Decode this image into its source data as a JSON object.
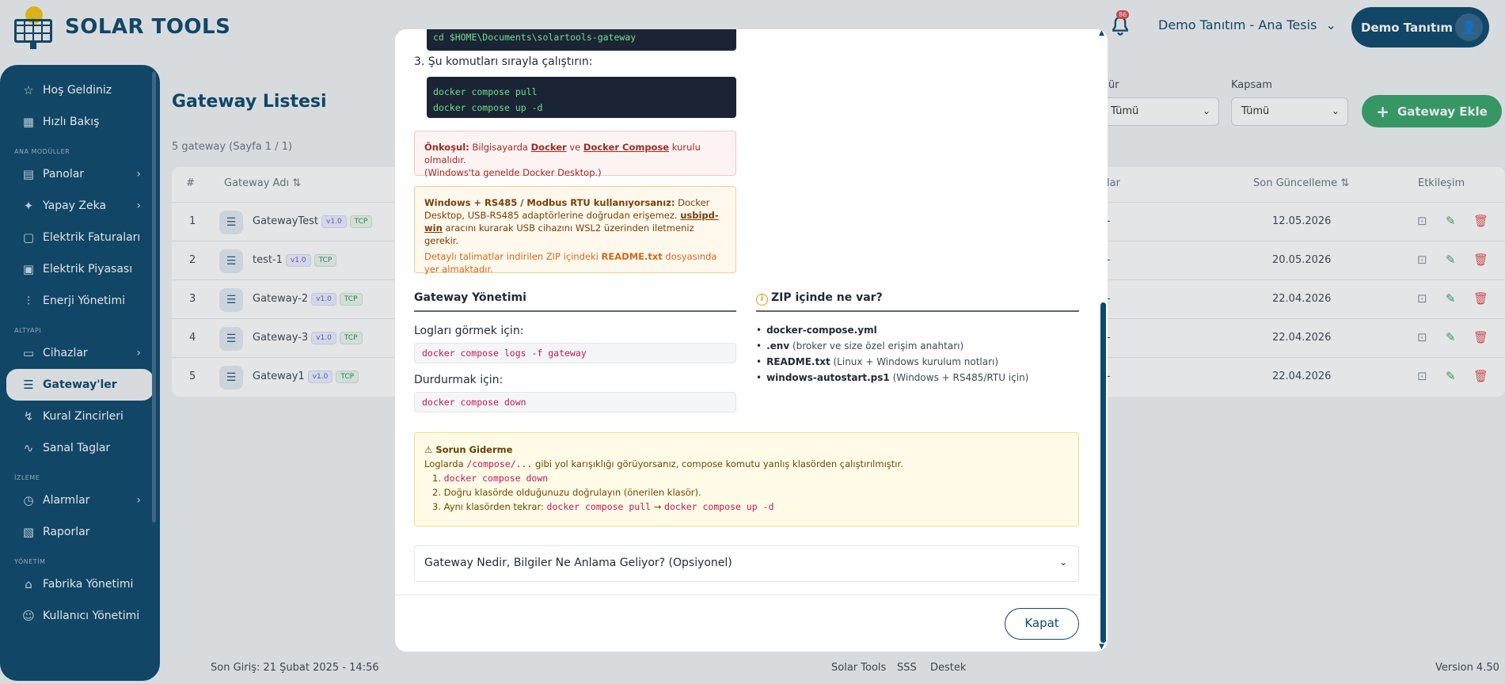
{
  "app": {
    "name": "SOLAR TOOLS"
  },
  "header": {
    "notification_count": "86",
    "tenant": "Demo Tanıtım - Ana Tesis",
    "user": "Demo Tanıtım"
  },
  "sidebar": {
    "items_top": [
      {
        "label": "Hoş Geldiniz",
        "icon": "star-icon"
      },
      {
        "label": "Hızlı Bakış",
        "icon": "grid-icon"
      }
    ],
    "section_modules": "ANA MODÜLLER",
    "items_modules": [
      {
        "label": "Panolar",
        "icon": "dashboard-icon"
      },
      {
        "label": "Yapay Zeka",
        "icon": "ai-icon"
      },
      {
        "label": "Elektrik Faturaları",
        "icon": "invoice-icon"
      },
      {
        "label": "Elektrik Piyasası",
        "icon": "market-icon"
      },
      {
        "label": "Enerji Yönetimi",
        "icon": "sliders-icon"
      }
    ],
    "section_infra": "ALTYAPI",
    "items_infra": [
      {
        "label": "Cihazlar",
        "icon": "monitor-icon"
      },
      {
        "label": "Gateway'ler",
        "icon": "server-icon"
      },
      {
        "label": "Kural Zincirleri",
        "icon": "chain-icon"
      },
      {
        "label": "Sanal Taglar",
        "icon": "pulse-icon"
      }
    ],
    "section_monitor": "İZLEME",
    "items_monitor": [
      {
        "label": "Alarmlar",
        "icon": "alarm-icon"
      },
      {
        "label": "Raporlar",
        "icon": "report-icon"
      }
    ],
    "section_admin": "YÖNETİM",
    "items_admin": [
      {
        "label": "Fabrika Yönetimi",
        "icon": "factory-icon"
      },
      {
        "label": "Kullanıcı Yönetimi",
        "icon": "users-icon"
      }
    ]
  },
  "page": {
    "title": "Gateway Listesi",
    "subtitle": "5 gateway (Sayfa 1 / 1)",
    "filter1_label": "ür",
    "filter1_value": "Tümü",
    "filter2_label": "Kapsam",
    "filter2_value": "Tümü",
    "add_button": "Gateway Ekle"
  },
  "table": {
    "headers": {
      "num": "#",
      "name": "Gateway Adı",
      "col_partial": "lar",
      "updated": "Son Güncelleme",
      "actions": "Etkileşim"
    },
    "rows": [
      {
        "num": "1",
        "name": "GatewayTest",
        "version": "v1.0",
        "protocol": "TCP",
        "partial": "-",
        "updated": "12.05.2026"
      },
      {
        "num": "2",
        "name": "test-1",
        "version": "v1.0",
        "protocol": "TCP",
        "partial": "-",
        "updated": "20.05.2026"
      },
      {
        "num": "3",
        "name": "Gateway-2",
        "version": "v1.0",
        "protocol": "TCP",
        "partial": "-",
        "updated": "22.04.2026"
      },
      {
        "num": "4",
        "name": "Gateway-3",
        "version": "v1.0",
        "protocol": "TCP",
        "partial": "-",
        "updated": "22.04.2026"
      },
      {
        "num": "5",
        "name": "Gateway1",
        "version": "v1.0",
        "protocol": "TCP",
        "partial": "-",
        "updated": "22.04.2026"
      }
    ]
  },
  "footer": {
    "last_login": "Son Giriş: 21 Şubat 2025 - 14:56",
    "links": [
      "Solar Tools",
      "SSS",
      "Destek"
    ],
    "version": "Version 4.50"
  },
  "modal": {
    "cd_cmd": "cd $HOME\\Documents\\solartools-gateway",
    "step3": "3. Şu komutları sırayla çalıştırın:",
    "step3_cmds": [
      "docker compose pull",
      "docker compose up -d"
    ],
    "prereq": {
      "title": "Önkoşul:",
      "t1": " Bilgisayarda ",
      "link1": "Docker",
      "t2": " ve ",
      "link2": "Docker Compose",
      "t3": " kurulu olmalıdır.",
      "t4": "(Windows'ta genelde Docker Desktop.)"
    },
    "windows": {
      "title": "Windows + RS485 / Modbus RTU kullanıyorsanız:",
      "t1": " Docker Desktop, USB-RS485 adaptörlerine doğrudan erişemez. ",
      "link": "usbipd-win",
      "t2": " aracını kurarak USB cihazını WSL2 üzerinden iletmeniz gerekir.",
      "note1": "Detaylı talimatlar indirilen ZIP içindeki ",
      "note_bold": "README.txt",
      "note2": " dosyasında yer almaktadır."
    },
    "mgmt": {
      "title": "Gateway Yönetimi",
      "logs_label": "Logları görmek için:",
      "logs_cmd": "docker compose logs -f gateway",
      "stop_label": "Durdurmak için:",
      "stop_cmd": "docker compose down"
    },
    "zip": {
      "title": "ZIP içinde ne var?",
      "items": [
        {
          "name": "docker-compose.yml",
          "desc": ""
        },
        {
          "name": ".env",
          "desc": " (broker ve size özel erişim anahtarı)"
        },
        {
          "name": "README.txt",
          "desc": " (Linux + Windows kurulum notları)"
        },
        {
          "name": "windows-autostart.ps1",
          "desc": " (Windows + RS485/RTU için)"
        }
      ]
    },
    "trouble": {
      "title": "Sorun Giderme",
      "t1": "Loglarda ",
      "path": "/compose/...",
      "t2": " gibi yol karışıklığı görüyorsanız, compose komutu yanlış klasörden çalıştırılmıştır.",
      "s1_num": "1.",
      "s1_cmd": "docker compose down",
      "s2": "2. Doğru klasörde olduğunuzu doğrulayın (önerilen klasör).",
      "s3_text": "3. Aynı klasörden tekrar: ",
      "s3_cmd1": "docker compose pull",
      "s3_arrow": " → ",
      "s3_cmd2": "docker compose up -d"
    },
    "accordion": "Gateway Nedir, Bilgiler Ne Anlama Geliyor? (Opsiyonel)",
    "close": "Kapat"
  }
}
